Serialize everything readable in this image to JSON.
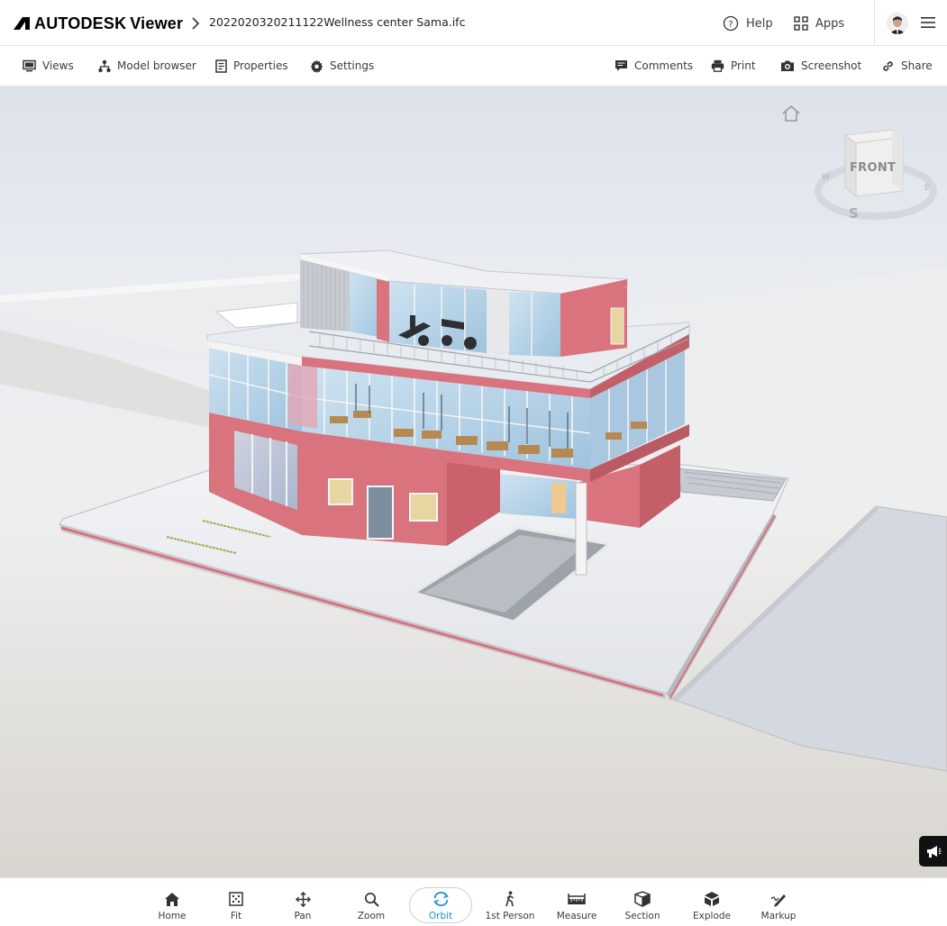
{
  "header": {
    "brand": "AUTODESK",
    "product": "Viewer",
    "filename": "2022020320211122Wellness center Sama.ifc",
    "help_label": "Help",
    "apps_label": "Apps"
  },
  "subbar": {
    "left": [
      {
        "label": "Views",
        "icon": "monitor-icon"
      },
      {
        "label": "Model browser",
        "icon": "tree-icon"
      },
      {
        "label": "Properties",
        "icon": "properties-icon"
      },
      {
        "label": "Settings",
        "icon": "gear-icon"
      }
    ],
    "right": [
      {
        "label": "Comments",
        "icon": "comment-icon"
      },
      {
        "label": "Print",
        "icon": "printer-icon"
      },
      {
        "label": "Screenshot",
        "icon": "camera-icon"
      },
      {
        "label": "Share",
        "icon": "link-icon"
      }
    ]
  },
  "viewcube": {
    "face": "FRONT",
    "compass": {
      "south": "S",
      "east": "E",
      "west": "W"
    }
  },
  "toolbar": {
    "active": "Orbit",
    "items": [
      {
        "label": "Home",
        "icon": "home-icon"
      },
      {
        "label": "Fit",
        "icon": "fit-icon"
      },
      {
        "label": "Pan",
        "icon": "pan-icon"
      },
      {
        "label": "Zoom",
        "icon": "zoom-icon"
      },
      {
        "label": "Orbit",
        "icon": "orbit-icon"
      },
      {
        "label": "1st Person",
        "icon": "walk-icon"
      },
      {
        "label": "Measure",
        "icon": "ruler-icon"
      },
      {
        "label": "Section",
        "icon": "section-icon"
      },
      {
        "label": "Explode",
        "icon": "explode-icon"
      },
      {
        "label": "Markup",
        "icon": "pen-icon"
      }
    ]
  },
  "colors": {
    "accent": "#1d91d0",
    "building_wall": "#d9737d",
    "glass": "#b9d6ea",
    "ground_slab": "#d6dbe4"
  }
}
